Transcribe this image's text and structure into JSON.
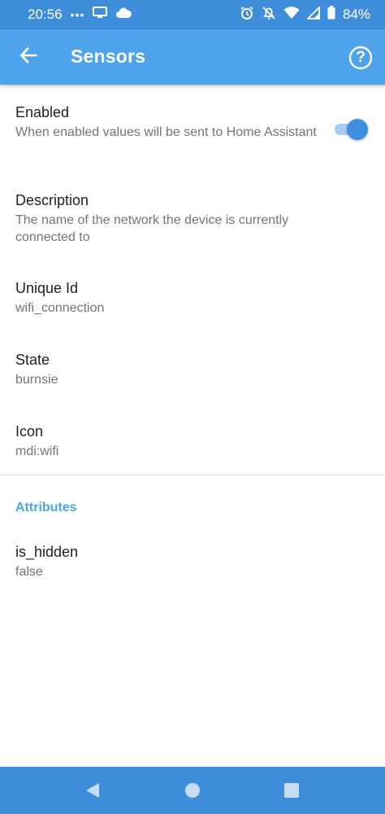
{
  "status_bar": {
    "time": "20:56",
    "dots": "•••",
    "battery_percent": "84%",
    "icons_left": [
      "cast-icon",
      "cloud-icon"
    ],
    "icons_right": [
      "alarm-icon",
      "mute-icon",
      "wifi-icon",
      "signal-icon",
      "battery-icon"
    ]
  },
  "app_bar": {
    "title": "Sensors",
    "help_icon_text": "?"
  },
  "preferences": [
    {
      "title": "Enabled",
      "summary": "When enabled values will be sent to Home Assistant",
      "toggle_on": true
    },
    {
      "title": "Description",
      "summary": "The name of the network the device is currently connected to"
    },
    {
      "title": "Unique Id",
      "summary": "wifi_connection"
    },
    {
      "title": "State",
      "summary": "burnsie"
    },
    {
      "title": "Icon",
      "summary": "mdi:wifi"
    }
  ],
  "attributes": {
    "header": "Attributes",
    "items": [
      {
        "title": "is_hidden",
        "summary": "false"
      }
    ]
  },
  "colors": {
    "status_bar": "#3f8edc",
    "app_bar": "#4ea3ea",
    "accent": "#3d8fdf"
  }
}
